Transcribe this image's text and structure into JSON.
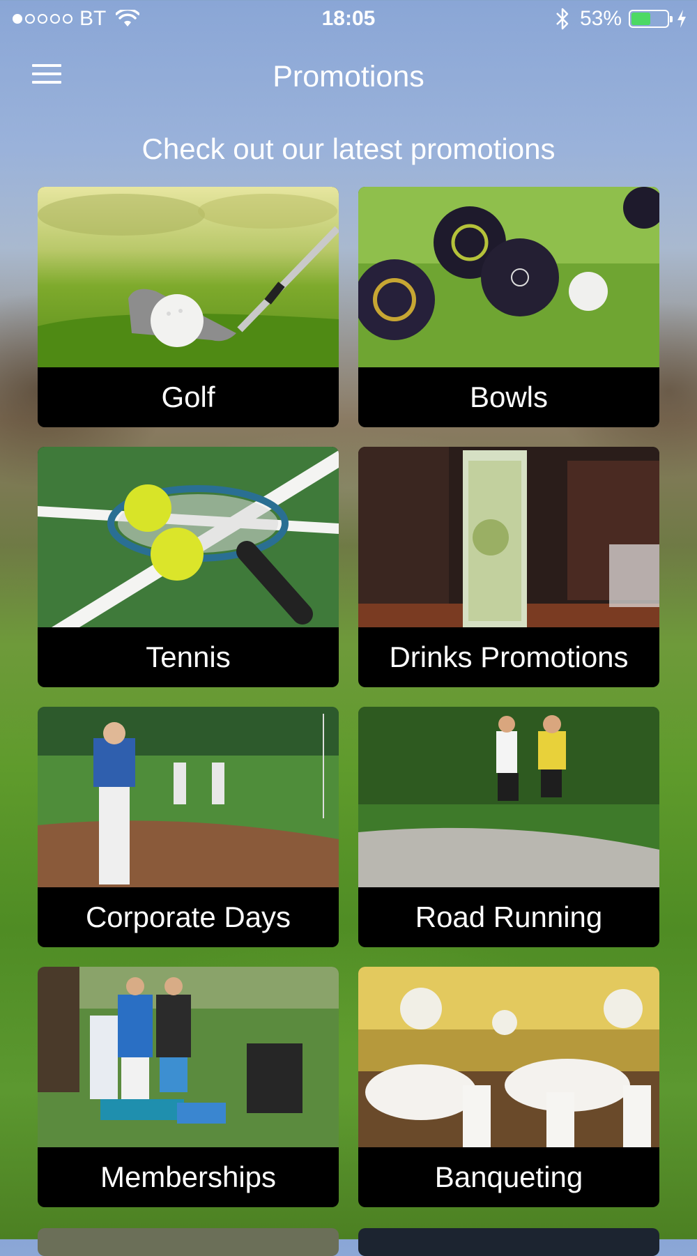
{
  "status_bar": {
    "carrier": "BT",
    "time": "18:05",
    "battery_percent": "53%",
    "battery_level": 0.53,
    "signal_bars_filled": 1,
    "signal_bars_total": 5
  },
  "header": {
    "title": "Promotions",
    "menu_icon": "hamburger-menu-icon"
  },
  "subtitle": "Check out our latest promotions",
  "promotions": [
    {
      "label": "Golf",
      "image": "golf-club-and-ball"
    },
    {
      "label": "Bowls",
      "image": "lawn-bowls"
    },
    {
      "label": "Tennis",
      "image": "tennis-racket-and-balls"
    },
    {
      "label": "Drinks Promotions",
      "image": "cocktail-glass"
    },
    {
      "label": "Corporate Days",
      "image": "golfers-on-course"
    },
    {
      "label": "Road Running",
      "image": "runners-in-park"
    },
    {
      "label": "Memberships",
      "image": "group-of-golfers"
    },
    {
      "label": "Banqueting",
      "image": "banquet-hall"
    }
  ],
  "colors": {
    "accent_battery": "#4cd964",
    "tile_label_bg": "#000000",
    "text": "#ffffff"
  }
}
